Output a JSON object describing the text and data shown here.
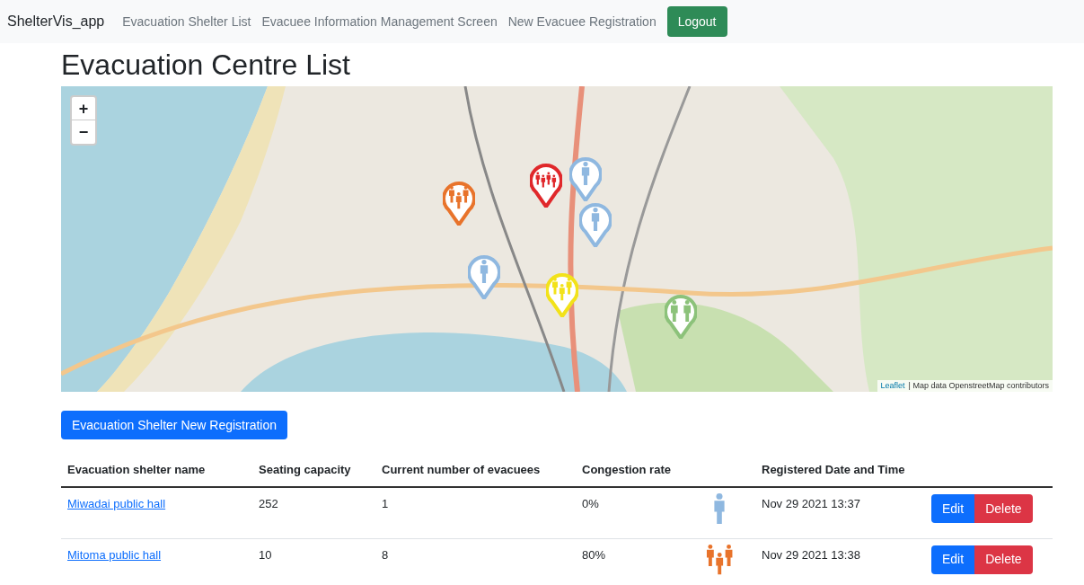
{
  "navbar": {
    "brand": "ShelterVis_app",
    "links": [
      {
        "label": "Evacuation Shelter List"
      },
      {
        "label": "Evacuee Information Management Screen"
      },
      {
        "label": "New Evacuee Registration"
      }
    ],
    "logout": "Logout"
  },
  "title": "Evacuation Centre List",
  "map": {
    "zoom_in": "+",
    "zoom_out": "−",
    "markers": [
      {
        "kind": "three",
        "color": "#e8732b"
      },
      {
        "kind": "four",
        "color": "#e0282b"
      },
      {
        "kind": "one",
        "color": "#8fb8e0"
      },
      {
        "kind": "one",
        "color": "#8fb8e0"
      },
      {
        "kind": "one",
        "color": "#8fb8e0"
      },
      {
        "kind": "three",
        "color": "#f2e21a"
      },
      {
        "kind": "two",
        "color": "#8cc27a"
      }
    ],
    "attribution_link": "Leaflet",
    "attribution_text": "| Map data OpenstreetMap contributors"
  },
  "new_button": "Evacuation Shelter New Registration",
  "table": {
    "columns": [
      "Evacuation shelter name",
      "Seating capacity",
      "Current number of evacuees",
      "Congestion rate",
      "Registered Date and Time"
    ],
    "rows": [
      {
        "name": "Miwadai public hall",
        "capacity": "252",
        "evacuees": "1",
        "rate": "0%",
        "icon": {
          "kind": "one",
          "color": "#8fb8e0"
        },
        "registered": "Nov 29 2021 13:37",
        "edit": "Edit",
        "delete": "Delete"
      },
      {
        "name": "Mitoma public hall",
        "capacity": "10",
        "evacuees": "8",
        "rate": "80%",
        "icon": {
          "kind": "three",
          "color": "#e8732b"
        },
        "registered": "Nov 29 2021 13:38",
        "edit": "Edit",
        "delete": "Delete"
      }
    ]
  }
}
